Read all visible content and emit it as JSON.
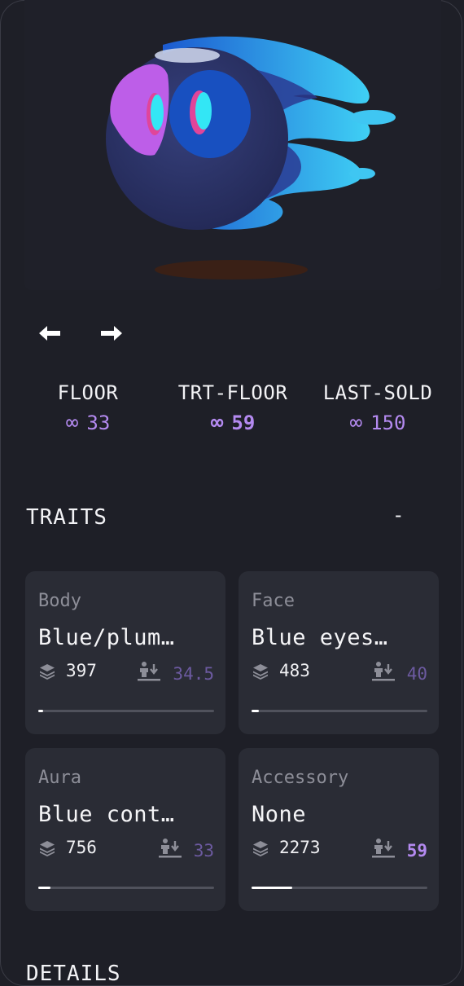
{
  "stats": [
    {
      "label": "FLOOR",
      "symbol": "∞",
      "value": "33"
    },
    {
      "label": "TRT-FLOOR",
      "symbol": "∞",
      "value": "59"
    },
    {
      "label": "LAST-SOLD",
      "symbol": "∞",
      "value": "150"
    }
  ],
  "traits": {
    "title": "TRAITS",
    "toggle": "-",
    "items": [
      {
        "category": "Body",
        "value": "Blue/plum…",
        "count": "397",
        "floor": "34.5",
        "rarity": 0.03
      },
      {
        "category": "Face",
        "value": "Blue eyes…",
        "count": "483",
        "floor": "40",
        "rarity": 0.04
      },
      {
        "category": "Aura",
        "value": "Blue cont…",
        "count": "756",
        "floor": "33",
        "rarity": 0.07
      },
      {
        "category": "Accessory",
        "value": "None",
        "count": "2273",
        "floor": "59",
        "rarity": 0.23
      }
    ]
  },
  "details": {
    "title": "DETAILS"
  },
  "colors": {
    "accent": "#b48af0",
    "muted_accent": "#6c5aa0",
    "card_bg": "#2a2c35",
    "page_bg": "#1e1f27"
  }
}
